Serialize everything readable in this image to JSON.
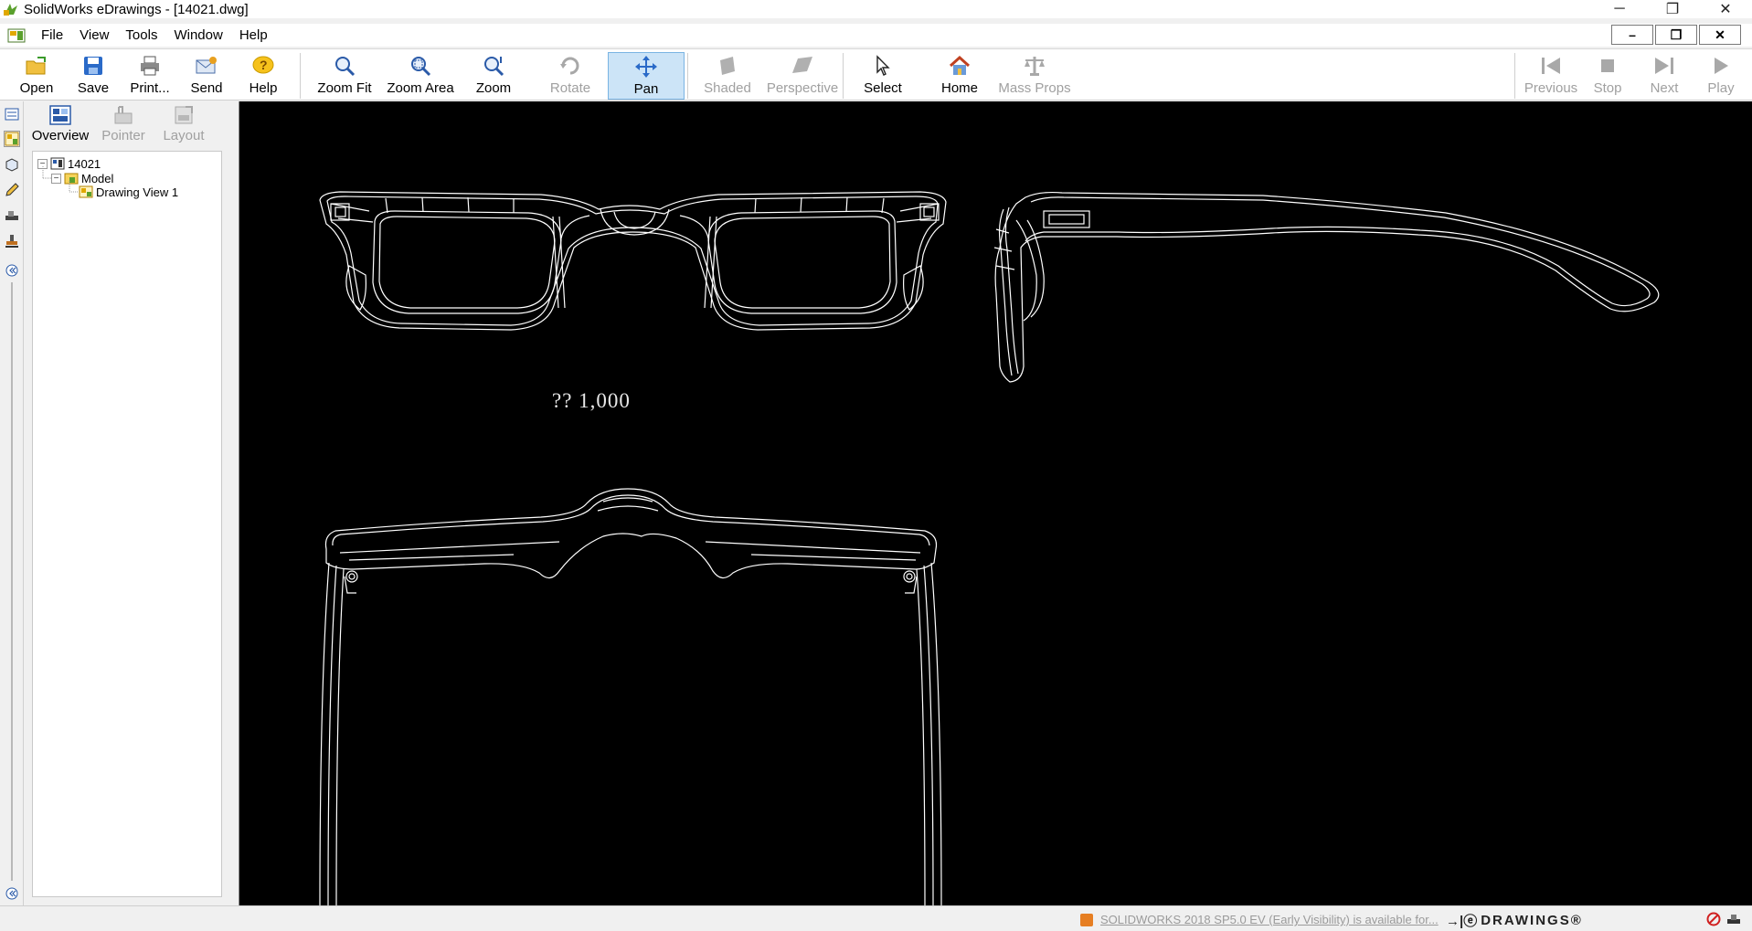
{
  "window": {
    "title": "SolidWorks eDrawings - [14021.dwg]",
    "controls": {
      "minimize": "─",
      "restore": "❐",
      "close": "✕"
    }
  },
  "menubar": {
    "items": [
      "File",
      "View",
      "Tools",
      "Window",
      "Help"
    ],
    "mdi_controls": {
      "minimize": "–",
      "restore": "❐",
      "close": "✕"
    }
  },
  "toolbar": {
    "buttons": [
      {
        "label": "Open",
        "icon": "open-folder-icon"
      },
      {
        "label": "Save",
        "icon": "save-disk-icon"
      },
      {
        "label": "Print...",
        "icon": "printer-icon"
      },
      {
        "label": "Send",
        "icon": "send-envelope-icon"
      },
      {
        "label": "Help",
        "icon": "help-icon"
      },
      {
        "label": "Zoom Fit",
        "icon": "zoom-fit-icon"
      },
      {
        "label": "Zoom Area",
        "icon": "zoom-area-icon"
      },
      {
        "label": "Zoom",
        "icon": "zoom-icon"
      },
      {
        "label": "Rotate",
        "icon": "rotate-icon",
        "state": "disabled"
      },
      {
        "label": "Pan",
        "icon": "pan-icon",
        "state": "active"
      },
      {
        "label": "Shaded",
        "icon": "shaded-icon",
        "state": "disabled"
      },
      {
        "label": "Perspective",
        "icon": "perspective-icon",
        "state": "disabled"
      },
      {
        "label": "Select",
        "icon": "select-cursor-icon"
      },
      {
        "label": "Home",
        "icon": "home-icon"
      },
      {
        "label": "Mass Props",
        "icon": "mass-props-scale-icon",
        "state": "disabled"
      },
      {
        "label": "Previous",
        "icon": "previous-icon",
        "state": "disabled"
      },
      {
        "label": "Stop",
        "icon": "stop-icon",
        "state": "disabled"
      },
      {
        "label": "Next",
        "icon": "next-icon",
        "state": "disabled"
      },
      {
        "label": "Play",
        "icon": "play-icon",
        "state": "disabled"
      }
    ]
  },
  "sidepanel": {
    "tabs": [
      {
        "label": "Overview",
        "icon": "overview-icon"
      },
      {
        "label": "Pointer",
        "icon": "pointer-icon",
        "state": "disabled"
      },
      {
        "label": "Layout",
        "icon": "layout-icon",
        "state": "disabled"
      }
    ],
    "tree": {
      "root": "14021",
      "child": "Model",
      "grandchild": "Drawing View 1",
      "expander_symbol": "−"
    }
  },
  "leftstrip": {
    "icons": [
      "sheet-icon",
      "overview-icon",
      "3d-box-icon",
      "markup-pencil-icon",
      "measure-icon",
      "stamp-icon",
      "collapse-left-icon"
    ]
  },
  "canvas": {
    "background": "#000000",
    "line_color": "#ffffff",
    "scale_label": "?? 1,000"
  },
  "statusbar": {
    "message": "SOLIDWORKS 2018 SP5.0 EV (Early Visibility) is available for...",
    "brand": "DRAWINGS®",
    "brand_prefix": "→|ⓔ"
  }
}
